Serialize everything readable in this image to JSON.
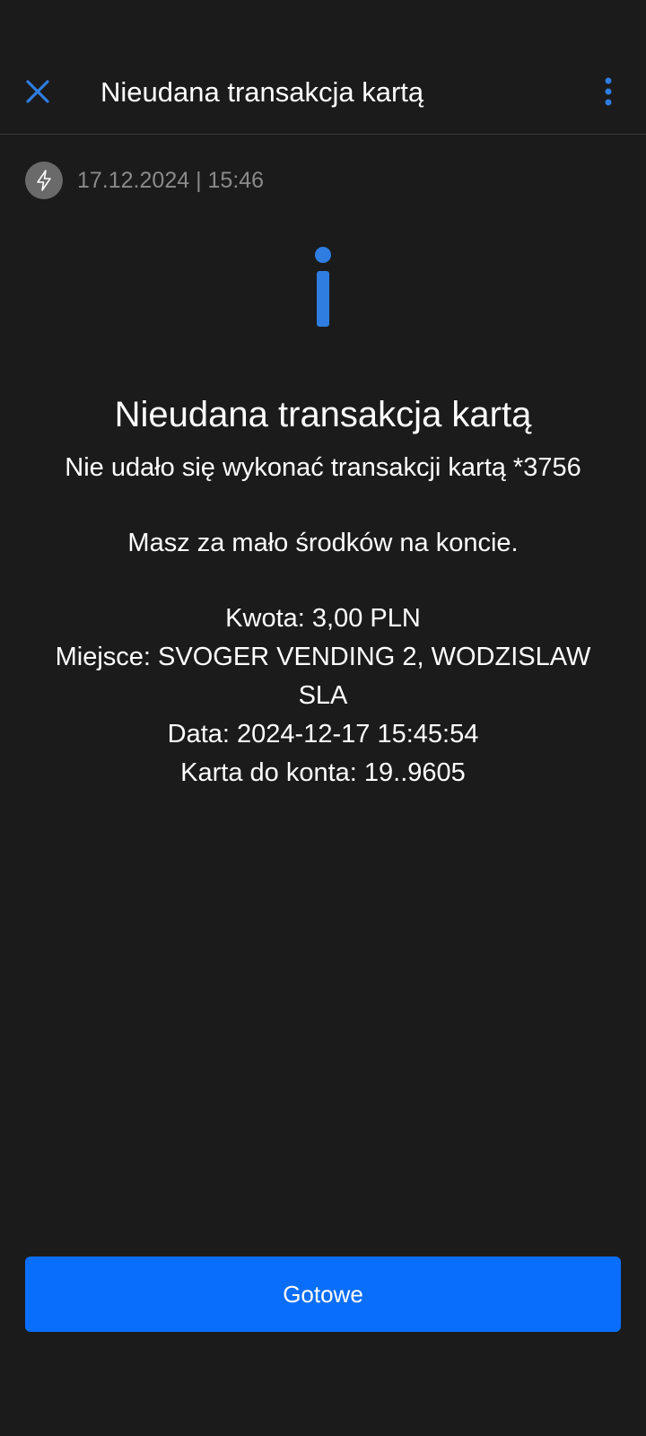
{
  "header": {
    "title": "Nieudana transakcja kartą",
    "close_icon": "close-icon",
    "menu_icon": "more-vertical-icon"
  },
  "meta": {
    "icon": "lightning-bolt-icon",
    "datetime": "17.12.2024 | 15:46"
  },
  "status_icon": "info-icon",
  "message": {
    "title": "Nieudana transakcja kartą",
    "subtitle": "Nie udało się wykonać transakcji kartą *3756",
    "reason": "Masz za mało środków na koncie.",
    "details": [
      "Kwota: 3,00 PLN",
      "Miejsce: SVOGER VENDING 2, WODZISLAW SLA",
      "Data: 2024-12-17 15:45:54",
      "Karta do konta: 19..9605"
    ]
  },
  "actions": {
    "done_label": "Gotowe"
  },
  "colors": {
    "background": "#1b1b1b",
    "accent": "#0a6efd",
    "icon_blue": "#2f7de1",
    "muted_text": "#8a8a8a"
  }
}
